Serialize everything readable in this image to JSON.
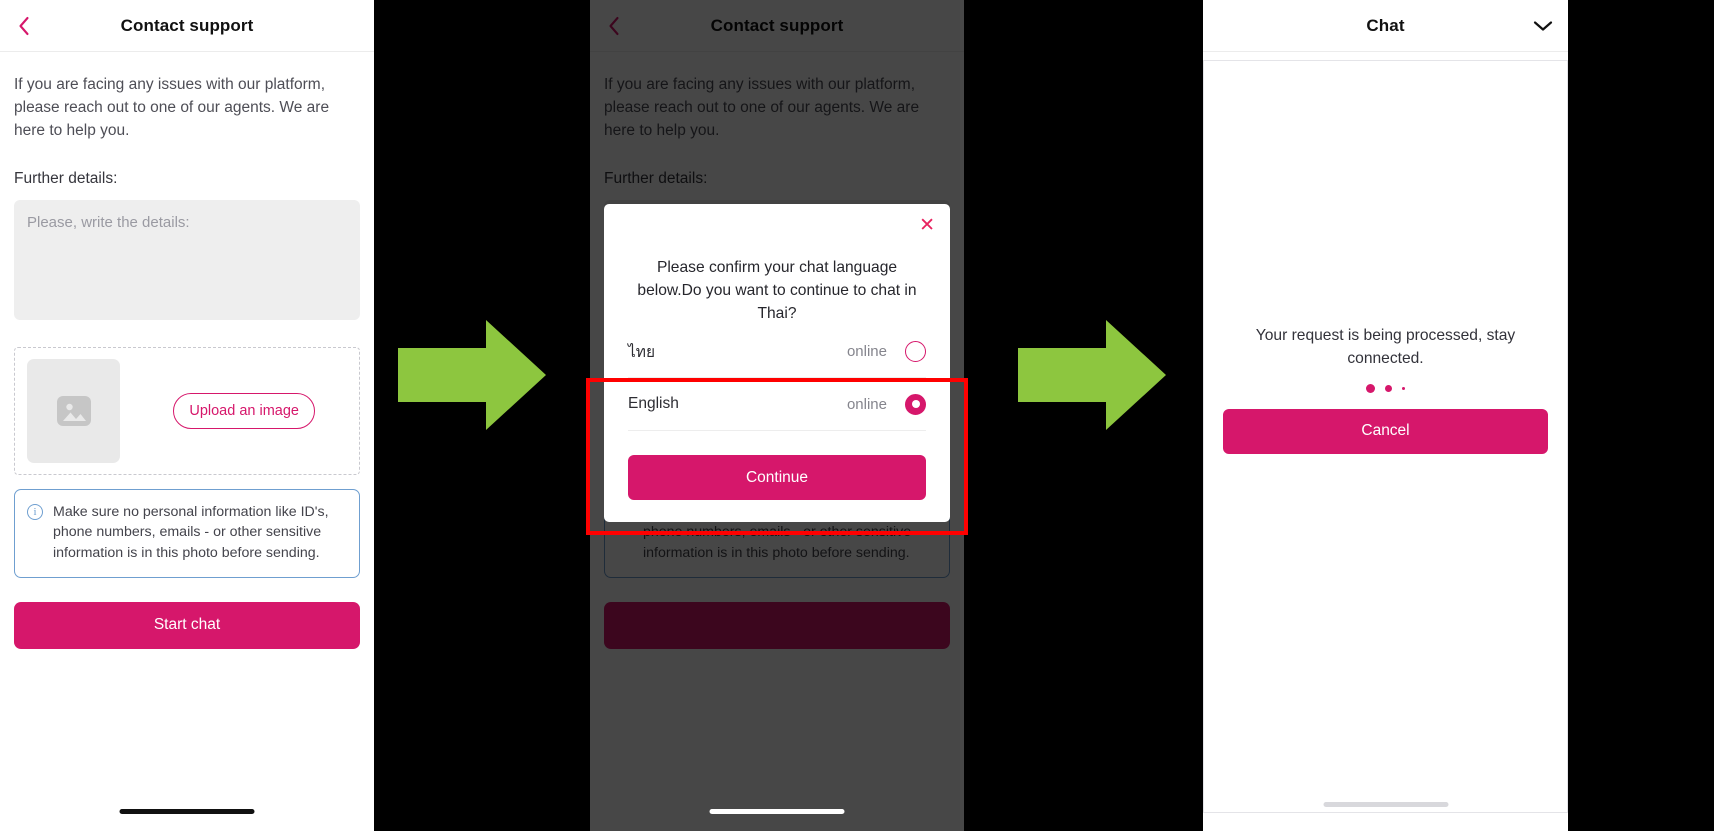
{
  "theme": {
    "accent": "#d6176b",
    "accent_bright": "#e8225f",
    "info_border": "#6f9fd0",
    "arrow_green": "#8dc63f",
    "annotation_red": "#ff0000",
    "dim": "rgba(0,0,0,0.72)",
    "textarea_bg": "#eeeeee",
    "page_bg": "#000000"
  },
  "panel1": {
    "nav": {
      "title": "Contact support",
      "back_icon": "chevron-left-icon"
    },
    "intro": "If you are facing any issues with our platform, please reach out to one of our agents. We are here to help you.",
    "further_label": "Further details:",
    "details_input": {
      "value": "",
      "placeholder": "Please, write the details:"
    },
    "upload": {
      "thumb_icon": "image-placeholder-icon",
      "button_label": "Upload an image"
    },
    "info": {
      "icon": "info-circle-icon",
      "text": "Make sure no personal information like ID's, phone numbers, emails - or other sensitive information is in this photo before sending."
    },
    "start_chat_label": "Start chat"
  },
  "panel2": {
    "nav": {
      "title": "Contact support",
      "back_icon": "chevron-left-icon"
    },
    "intro": "If you are facing any issues with our platform, please reach out to one of our agents. We are here to help you.",
    "further_label": "Further details:",
    "details_input": {
      "value": "",
      "placeholder": "Please, write the details:"
    },
    "info": {
      "icon": "info-circle-icon",
      "text": "Make sure no personal information like ID's, phone numbers, emails - or other sensitive information is in this photo before sending."
    },
    "modal": {
      "close_icon": "close-x-icon",
      "title": "Please confirm your chat language below.Do you want to continue to chat in Thai?",
      "languages": [
        {
          "label": "ไทย",
          "status": "online",
          "selected": false
        },
        {
          "label": "English",
          "status": "online",
          "selected": true
        }
      ],
      "continue_label": "Continue"
    }
  },
  "panel3": {
    "nav": {
      "title": "Chat",
      "collapse_icon": "chevron-down-icon"
    },
    "message": "Your request is being processed, stay connected.",
    "loading_dots": 3,
    "cancel_label": "Cancel"
  },
  "flow": {
    "arrows": [
      {
        "name": "step-arrow-1",
        "icon": "arrow-right-icon"
      },
      {
        "name": "step-arrow-2",
        "icon": "arrow-right-icon"
      }
    ],
    "annotation": {
      "name": "highlight-rectangle",
      "shape": "rectangle",
      "color": "#ff0000"
    }
  }
}
